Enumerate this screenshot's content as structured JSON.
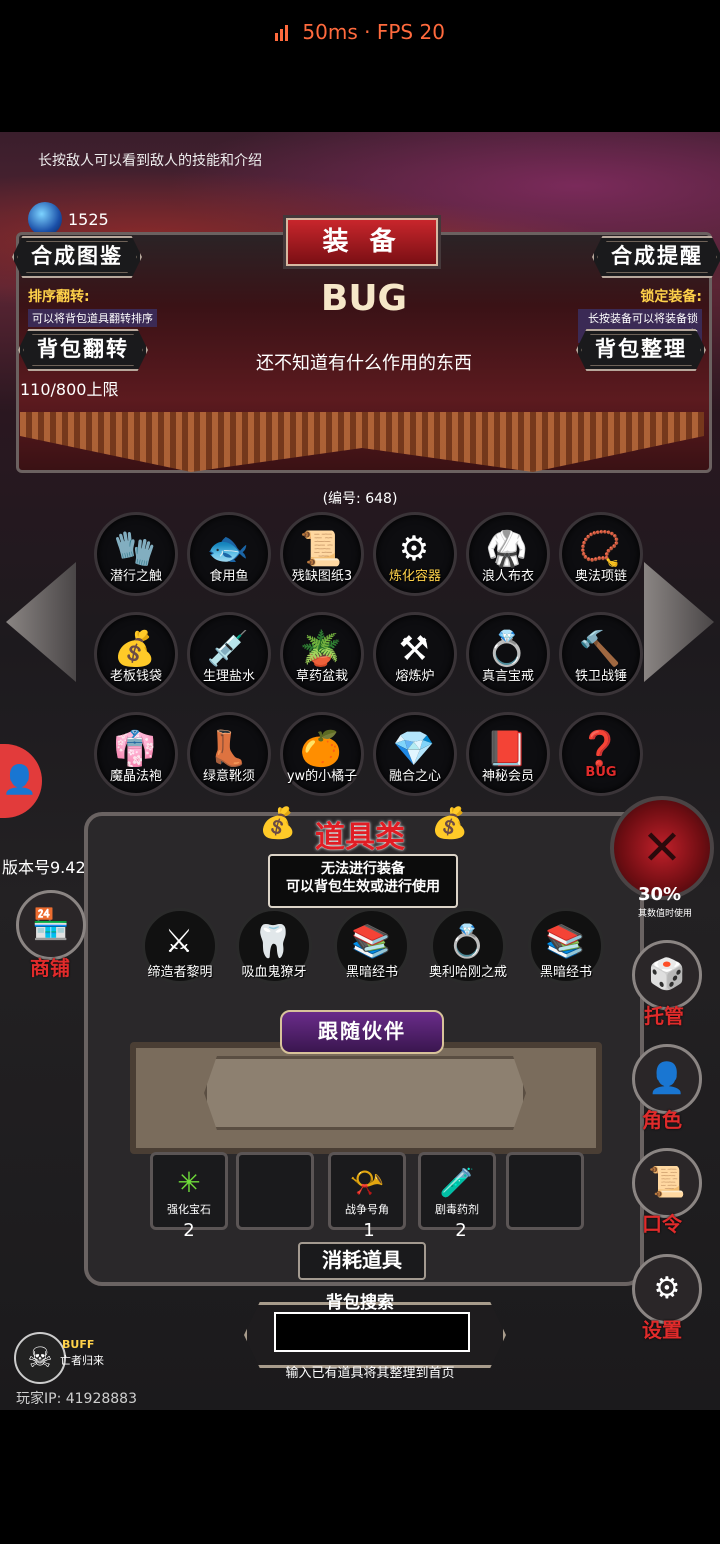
{
  "status": {
    "latency": "50ms",
    "separator": "·",
    "fps": "FPS 20"
  },
  "hint": "长按敌人可以看到敌人的技能和介绍",
  "gems": {
    "count": "1525"
  },
  "banner": {
    "title": "装 备",
    "left_button": "合成图鉴",
    "right_button": "合成提醒",
    "sort_title": "排序翻转:",
    "sort_desc": "可以将背包道具翻转排序",
    "lock_title": "锁定装备:",
    "lock_desc": "长按装备可以将装备锁定",
    "flip_button": "背包翻转",
    "tidy_button": "背包整理",
    "item_name": "BUG",
    "item_desc": "还不知道有什么作用的东西",
    "capacity": "110/800上限"
  },
  "serial": "(编号: 648)",
  "items": [
    {
      "label": "潜行之触",
      "icon": "🧤"
    },
    {
      "label": "食用鱼",
      "icon": "🐟"
    },
    {
      "label": "残缺图纸3",
      "icon": "📜"
    },
    {
      "label": "炼化容器",
      "icon": "⚙"
    },
    {
      "label": "浪人布衣",
      "icon": "🥋"
    },
    {
      "label": "奥法项链",
      "icon": "📿"
    },
    {
      "label": "老板钱袋",
      "icon": "💰"
    },
    {
      "label": "生理盐水",
      "icon": "💉"
    },
    {
      "label": "草药盆栽",
      "icon": "🪴"
    },
    {
      "label": "熔炼炉",
      "icon": "⚒"
    },
    {
      "label": "真言宝戒",
      "icon": "💍"
    },
    {
      "label": "铁卫战锤",
      "icon": "🔨"
    },
    {
      "label": "魔晶法袍",
      "icon": "👘"
    },
    {
      "label": "绿意靴须",
      "icon": "👢"
    },
    {
      "label": "yw的小橘子",
      "icon": "🍊"
    },
    {
      "label": "融合之心",
      "icon": "💎"
    },
    {
      "label": "神秘会员",
      "icon": "📕"
    },
    {
      "label": "BUG",
      "icon": "❓"
    }
  ],
  "tools": {
    "title": "道具类",
    "line1": "无法进行装备",
    "line2": "可以背包生效或进行使用",
    "slots": [
      {
        "label": "缔造者黎明",
        "icon": "⚔"
      },
      {
        "label": "吸血鬼獠牙",
        "icon": "🦷"
      },
      {
        "label": "黑暗经书",
        "icon": "📚"
      },
      {
        "label": "奥利哈刚之戒",
        "icon": "💍"
      },
      {
        "label": "黑暗经书",
        "icon": "📚"
      }
    ]
  },
  "follower": {
    "title": "跟随伙伴"
  },
  "consumables": {
    "title": "消耗道具",
    "slots": [
      {
        "label": "强化宝石",
        "icon": "✳",
        "count": "2"
      },
      {
        "label": "",
        "icon": "",
        "count": ""
      },
      {
        "label": "战争号角",
        "icon": "📯",
        "count": "1"
      },
      {
        "label": "剧毒药剂",
        "icon": "🧪",
        "count": "2"
      },
      {
        "label": "",
        "icon": "",
        "count": ""
      }
    ]
  },
  "search": {
    "label": "背包搜索",
    "placeholder": "",
    "hint": "输入已有道具将其整理到首页"
  },
  "side": {
    "shop": "商铺",
    "dice": "托管",
    "role": "角色",
    "code": "口令",
    "settings": "设置"
  },
  "pct": "30%",
  "pct_sub": "其数值时使用",
  "version": "版本号9.42",
  "buff": {
    "title": "BUFF",
    "sub": "亡者归来"
  },
  "player_ip": "玩家IP: 41928883",
  "colors": {
    "accent_red": "#e02b2b",
    "status_orange": "#ff6a3d",
    "gold": "#ffd24a"
  }
}
